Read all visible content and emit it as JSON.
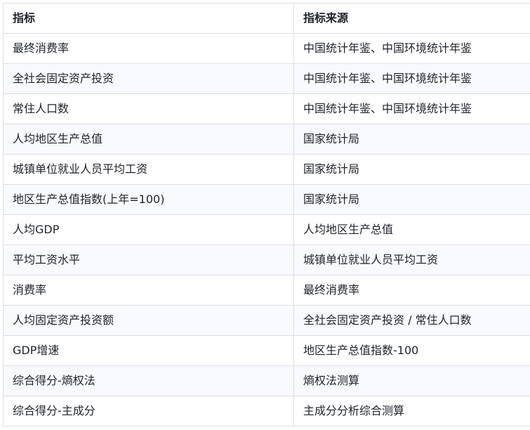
{
  "table": {
    "headers": [
      "指标",
      "指标来源"
    ],
    "rows": [
      [
        "最终消费率",
        "中国统计年鉴、中国环境统计年鉴"
      ],
      [
        "全社会固定资产投资",
        "中国统计年鉴、中国环境统计年鉴"
      ],
      [
        "常住人口数",
        "中国统计年鉴、中国环境统计年鉴"
      ],
      [
        "人均地区生产总值",
        "国家统计局"
      ],
      [
        "城镇单位就业人员平均工资",
        "国家统计局"
      ],
      [
        "地区生产总值指数(上年=100)",
        "国家统计局"
      ],
      [
        "人均GDP",
        "人均地区生产总值"
      ],
      [
        "平均工资水平",
        "城镇单位就业人员平均工资"
      ],
      [
        "消费率",
        "最终消费率"
      ],
      [
        "人均固定资产投资额",
        "全社会固定资产投资 / 常住人口数"
      ],
      [
        "GDP增速",
        "地区生产总值指数-100"
      ],
      [
        "综合得分-熵权法",
        "熵权法测算"
      ],
      [
        "综合得分-主成分",
        "主成分分析综合测算"
      ]
    ]
  }
}
